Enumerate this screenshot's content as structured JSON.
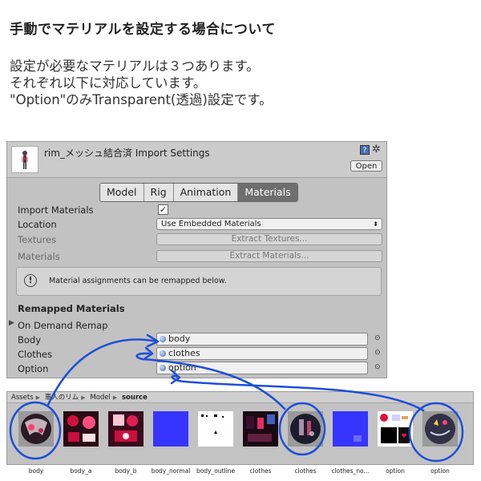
{
  "heading": "手動でマテリアルを設定する場合について",
  "paragraph": [
    "設定が必要なマテリアルは３つあります。",
    "それぞれ以下に対応しています。",
    "\"Option\"のみTransparent(透過)設定です。"
  ],
  "panel": {
    "title": "rim_メッシュ結合済 Import Settings",
    "help_icon": "?",
    "open_label": "Open",
    "tabs": [
      "Model",
      "Rig",
      "Animation",
      "Materials"
    ],
    "active_tab": "Materials",
    "import_materials_label": "Import Materials",
    "import_materials_checked": true,
    "location_label": "Location",
    "location_value": "Use Embedded Materials",
    "textures_label": "Textures",
    "extract_textures_label": "Extract Textures...",
    "materials_label": "Materials",
    "extract_materials_label": "Extract Materials...",
    "notice_text": "Material assignments can be remapped below.",
    "remapped_title": "Remapped Materials",
    "on_demand_label": "On Demand Remap",
    "slots": [
      {
        "label": "Body",
        "value": "body"
      },
      {
        "label": "Clothes",
        "value": "clothes"
      },
      {
        "label": "Option",
        "value": "option"
      }
    ]
  },
  "browser": {
    "breadcrumb": [
      "Assets",
      "車人のリム",
      "Model",
      "source"
    ],
    "assets": [
      {
        "label": "body",
        "kind": "material-sphere",
        "color": "#2a1a22"
      },
      {
        "label": "body_a",
        "kind": "texture",
        "color": "#c8103a"
      },
      {
        "label": "body_b",
        "kind": "texture",
        "color": "#c8103a"
      },
      {
        "label": "body_normal",
        "kind": "texture",
        "color": "#3535ff"
      },
      {
        "label": "body_outline",
        "kind": "texture",
        "color": "#ffffff"
      },
      {
        "label": "clothes",
        "kind": "texture",
        "color": "#1a0a14"
      },
      {
        "label": "clothes",
        "kind": "material-sphere",
        "color": "#1c1c2c"
      },
      {
        "label": "clothes_no...",
        "kind": "texture",
        "color": "#3535ff"
      },
      {
        "label": "option",
        "kind": "texture",
        "color": "#ffffff"
      },
      {
        "label": "option",
        "kind": "material-sphere",
        "color": "#303046"
      }
    ]
  },
  "colors": {
    "annotation": "#1e4fd8",
    "panel_bg": "#c2c2c2",
    "active_tab": "#6e6e6e"
  }
}
